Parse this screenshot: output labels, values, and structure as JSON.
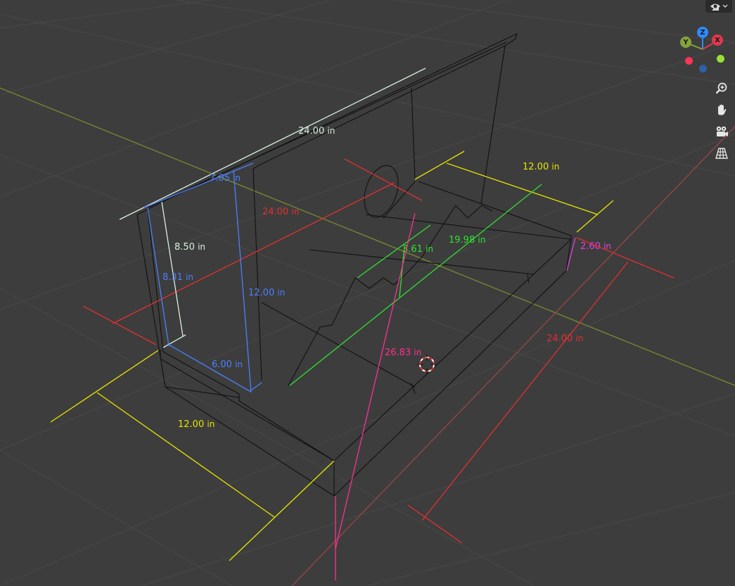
{
  "viewport": {
    "background": "#3d3d3d",
    "grid_color": "#474747",
    "axis_x_color": "#9a4646",
    "axis_y_color": "#7a8a30"
  },
  "dimensions": [
    {
      "id": "roof-length",
      "value": "24.00",
      "unit": "in",
      "color": "#d8f0e0"
    },
    {
      "id": "roof-slope-blue",
      "value": "7.05",
      "unit": "in",
      "color": "#4a80ff"
    },
    {
      "id": "depth-red",
      "value": "24.00",
      "unit": "in",
      "color": "#e03030"
    },
    {
      "id": "top-width-yellow",
      "value": "12.00",
      "unit": "in",
      "color": "#e6e600"
    },
    {
      "id": "wall-height-white",
      "value": "8.50",
      "unit": "in",
      "color": "#d8f0e0"
    },
    {
      "id": "wall-height-blue",
      "value": "8.31",
      "unit": "in",
      "color": "#4a80ff"
    },
    {
      "id": "back-height-blue",
      "value": "12.00",
      "unit": "in",
      "color": "#4a80ff"
    },
    {
      "id": "bottom-blue",
      "value": "6.00",
      "unit": "in",
      "color": "#4a80ff"
    },
    {
      "id": "stair-rise-green",
      "value": "3.61",
      "unit": "in",
      "color": "#30e030"
    },
    {
      "id": "stair-length-green",
      "value": "19.98",
      "unit": "in",
      "color": "#30e030"
    },
    {
      "id": "side-height-magenta",
      "value": "2.60",
      "unit": "in",
      "color": "#e040e0"
    },
    {
      "id": "diagonal-pink",
      "value": "26.83",
      "unit": "in",
      "color": "#ff3090"
    },
    {
      "id": "side-length-red",
      "value": "24.00",
      "unit": "in",
      "color": "#e03030"
    },
    {
      "id": "front-width-yellow",
      "value": "12.00",
      "unit": "in",
      "color": "#e6e600"
    }
  ],
  "gizmo": {
    "z_label": "Z",
    "y_label": "Y",
    "x_label": "X",
    "z_color": "#2e8bff",
    "y_color": "#86a33a",
    "x_color": "#e0394d",
    "neg_x_color": "#ff3355",
    "neg_y_color": "#9be036",
    "neg_z_color": "#2f5fa8"
  },
  "navigation": {
    "buttons": [
      {
        "name": "zoom-button",
        "icon": "magnifier-plus-icon"
      },
      {
        "name": "pan-button",
        "icon": "hand-icon"
      },
      {
        "name": "camera-view-button",
        "icon": "camera-icon"
      },
      {
        "name": "perspective-toggle-button",
        "icon": "grid-perspective-icon"
      }
    ]
  },
  "visibility": {
    "icon": "eye-icon",
    "dropdown_icon": "chevron-down-icon"
  }
}
